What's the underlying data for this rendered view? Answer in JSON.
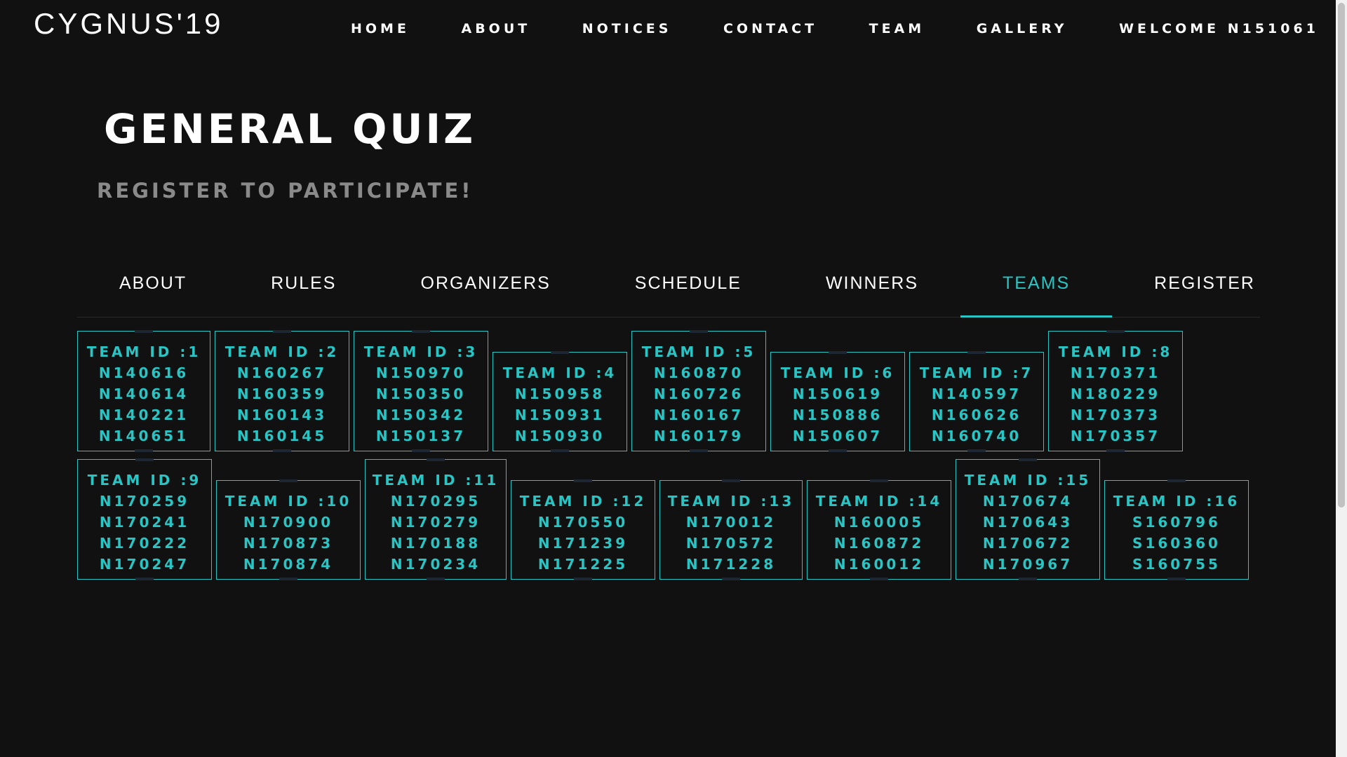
{
  "header": {
    "brand": "CYGNUS'19",
    "nav": [
      "HOME",
      "ABOUT",
      "NOTICES",
      "CONTACT",
      "TEAM",
      "GALLERY",
      "WELCOME N151061"
    ]
  },
  "event": {
    "title": "GENERAL QUIZ",
    "subtitle": "REGISTER TO PARTICIPATE!"
  },
  "tabs": {
    "items": [
      "ABOUT",
      "RULES",
      "ORGANIZERS",
      "SCHEDULE",
      "WINNERS",
      "TEAMS",
      "REGISTER"
    ],
    "active": "TEAMS"
  },
  "teams": [
    {
      "label": "TEAM ID :1",
      "members": [
        "N140616",
        "N140614",
        "N140221",
        "N140651"
      ]
    },
    {
      "label": "TEAM ID :2",
      "members": [
        "N160267",
        "N160359",
        "N160143",
        "N160145"
      ]
    },
    {
      "label": "TEAM ID :3",
      "members": [
        "N150970",
        "N150350",
        "N150342",
        "N150137"
      ]
    },
    {
      "label": "TEAM ID :4",
      "members": [
        "N150958",
        "N150931",
        "N150930"
      ]
    },
    {
      "label": "TEAM ID :5",
      "members": [
        "N160870",
        "N160726",
        "N160167",
        "N160179"
      ]
    },
    {
      "label": "TEAM ID :6",
      "members": [
        "N150619",
        "N150886",
        "N150607"
      ]
    },
    {
      "label": "TEAM ID :7",
      "members": [
        "N140597",
        "N160626",
        "N160740"
      ]
    },
    {
      "label": "TEAM ID :8",
      "members": [
        "N170371",
        "N180229",
        "N170373",
        "N170357"
      ]
    },
    {
      "label": "TEAM ID :9",
      "members": [
        "N170259",
        "N170241",
        "N170222",
        "N170247"
      ]
    },
    {
      "label": "TEAM ID :10",
      "members": [
        "N170900",
        "N170873",
        "N170874"
      ]
    },
    {
      "label": "TEAM ID :11",
      "members": [
        "N170295",
        "N170279",
        "N170188",
        "N170234"
      ]
    },
    {
      "label": "TEAM ID :12",
      "members": [
        "N170550",
        "N171239",
        "N171225"
      ]
    },
    {
      "label": "TEAM ID :13",
      "members": [
        "N170012",
        "N170572",
        "N171228"
      ]
    },
    {
      "label": "TEAM ID :14",
      "members": [
        "N160005",
        "N160872",
        "N160012"
      ]
    },
    {
      "label": "TEAM ID :15",
      "members": [
        "N170674",
        "N170643",
        "N170672",
        "N170967"
      ]
    },
    {
      "label": "TEAM ID :16",
      "members": [
        "S160796",
        "S160360",
        "S160755"
      ]
    }
  ]
}
